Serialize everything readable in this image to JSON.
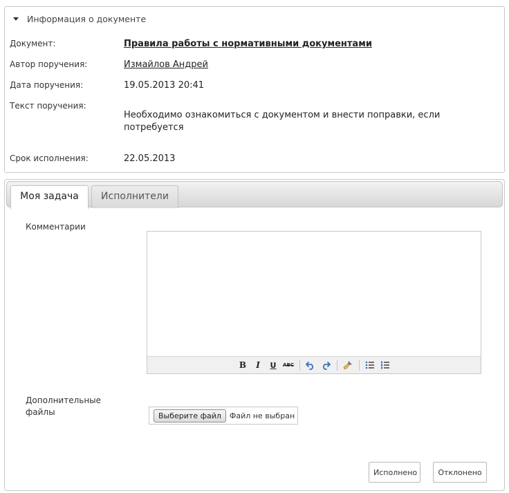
{
  "info": {
    "header": "Информация о документе",
    "rows": [
      {
        "label": "Документ:",
        "value": "Правила работы с нормативными документами"
      },
      {
        "label": "Автор поручения:",
        "value": "Измайлов Андрей"
      },
      {
        "label": "Дата поручения:",
        "value": "19.05.2013 20:41"
      },
      {
        "label": "Текст поручения:",
        "value": "Необходимо ознакомиться с документом и внести поправки, если потребуется"
      },
      {
        "label": "Срок исполнения:",
        "value": "22.05.2013"
      }
    ]
  },
  "tabs": [
    {
      "label": "Моя задача",
      "active": true
    },
    {
      "label": "Исполнители",
      "active": false
    }
  ],
  "form": {
    "comments_label": "Комментарии",
    "comments_value": "",
    "files_label": "Дополнительные файлы",
    "file_button": "Выберите файл",
    "file_status": "Файл не выбран"
  },
  "toolbar": {
    "bold": "B",
    "italic": "I",
    "underline": "U",
    "strike": "ABC"
  },
  "actions": {
    "done": "Исполнено",
    "reject": "Отклонено"
  },
  "colors": {
    "border": "#c8c8c8",
    "tab_strip": "#d7d7d7",
    "toolbar_bg": "#f0f0f0",
    "undo_blue": "#3a6fb5"
  }
}
